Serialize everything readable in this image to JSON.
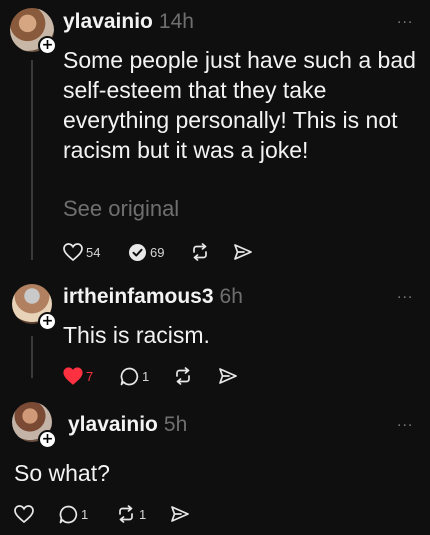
{
  "posts": [
    {
      "username": "ylavainio",
      "time": "14h",
      "more": "...",
      "text": "Some people just have such a bad self-esteem that they take everything personally! This is not racism but it was a joke!",
      "see_original": "See original",
      "likes": "54",
      "comments": "69"
    },
    {
      "username": "irtheinfamous3",
      "time": "6h",
      "more": "...",
      "text": "This is racism.",
      "likes": "7",
      "comments": "1",
      "liked": true
    },
    {
      "username": "ylavainio",
      "time": "5h",
      "more": "...",
      "text": "So what?",
      "comments": "1",
      "reposts": "1"
    }
  ],
  "icons": {
    "like": "heart-icon",
    "comment": "comment-icon",
    "repost": "repost-icon",
    "share": "share-icon",
    "follow": "plus-icon"
  },
  "colors": {
    "background": "#0f0f0f",
    "text": "#f3f3f3",
    "muted": "#6f6f6f",
    "liked": "#ff3040"
  }
}
